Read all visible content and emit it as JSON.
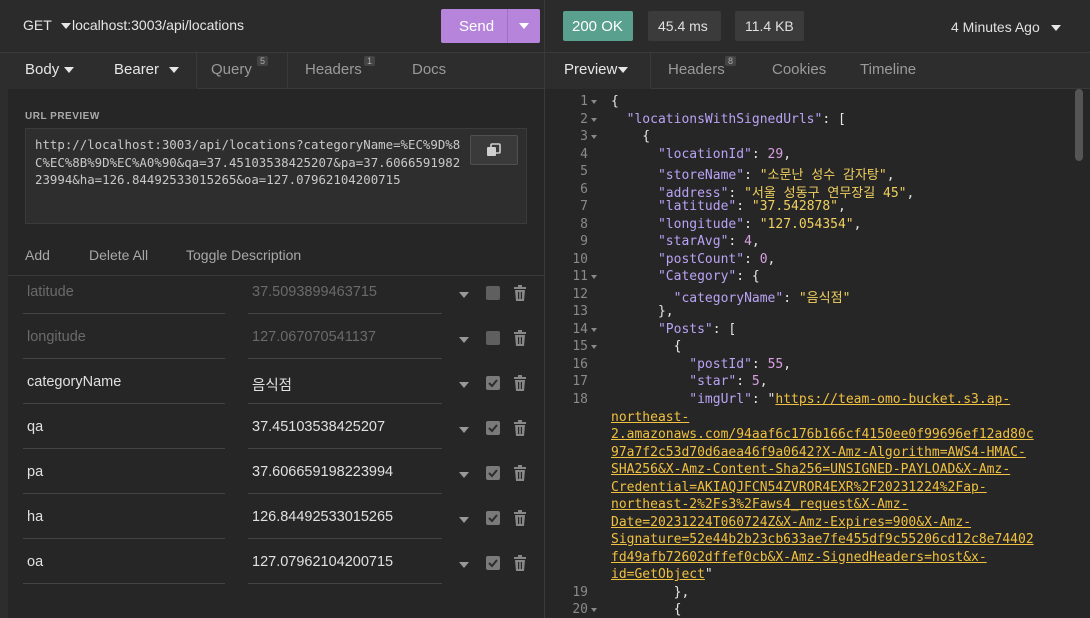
{
  "request": {
    "method": "GET",
    "url": "localhost:3003/api/locations",
    "send_label": "Send"
  },
  "response_meta": {
    "status": "200 OK",
    "time": "45.4 ms",
    "size": "11.4 KB",
    "ago": "4 Minutes Ago"
  },
  "left_tabs": [
    {
      "label": "Body",
      "badge": ""
    },
    {
      "label": "Bearer",
      "badge": ""
    },
    {
      "label": "Query",
      "badge": "5"
    },
    {
      "label": "Headers",
      "badge": "1"
    },
    {
      "label": "Docs",
      "badge": ""
    }
  ],
  "right_tabs": [
    {
      "label": "Preview",
      "badge": ""
    },
    {
      "label": "Headers",
      "badge": "8"
    },
    {
      "label": "Cookies",
      "badge": ""
    },
    {
      "label": "Timeline",
      "badge": ""
    }
  ],
  "url_preview": {
    "label": "URL PREVIEW",
    "text": "http://localhost:3003/api/locations?categoryName=%EC%9D%8C%EC%8B%9D%EC%A0%90&qa=37.45103538425207&pa=37.606659198223994&ha=126.84492533015265&oa=127.07962104200715"
  },
  "query_actions": {
    "add": "Add",
    "delete_all": "Delete All",
    "toggle_description": "Toggle Description"
  },
  "params": [
    {
      "name": "latitude",
      "value": "37.5093899463715",
      "enabled": false
    },
    {
      "name": "longitude",
      "value": "127.067070541137",
      "enabled": false
    },
    {
      "name": "categoryName",
      "value": "음식점",
      "enabled": true
    },
    {
      "name": "qa",
      "value": "37.45103538425207",
      "enabled": true
    },
    {
      "name": "pa",
      "value": "37.606659198223994",
      "enabled": true
    },
    {
      "name": "ha",
      "value": "126.84492533015265",
      "enabled": true
    },
    {
      "name": "oa",
      "value": "127.07962104200715",
      "enabled": true
    }
  ],
  "code": {
    "line_numbers": [
      "1",
      "2",
      "3",
      "4",
      "5",
      "6",
      "7",
      "8",
      "9",
      "10",
      "11",
      "12",
      "13",
      "14",
      "15",
      "16",
      "17",
      "18",
      "19",
      "20"
    ],
    "folds": [
      "1",
      "2",
      "3",
      "11",
      "14",
      "15",
      "20"
    ],
    "keys": {
      "root": "\"locationsWithSignedUrls\"",
      "locationId": "\"locationId\"",
      "storeName": "\"storeName\"",
      "address": "\"address\"",
      "latitude": "\"latitude\"",
      "longitude": "\"longitude\"",
      "starAvg": "\"starAvg\"",
      "postCount": "\"postCount\"",
      "Category": "\"Category\"",
      "categoryName": "\"categoryName\"",
      "Posts": "\"Posts\"",
      "postId": "\"postId\"",
      "star": "\"star\"",
      "imgUrl": "\"imgUrl\""
    },
    "values": {
      "locationId": "29",
      "storeName": "\"소문난 성수 감자탕\"",
      "address": "\"서울 성동구 연무장길 45\"",
      "latitude": "\"37.542878\"",
      "longitude": "\"127.054354\"",
      "starAvg": "4",
      "postCount": "0",
      "categoryName": "\"음식점\"",
      "postId": "55",
      "star": "5"
    },
    "img_url_lines": [
      "https://team-omo-bucket.s3.ap-",
      "northeast-",
      "2.amazonaws.com/94aaf6c176b166cf4150ee0f99696ef12ad80c",
      "97a7f2c53d70d6aea46f9a0642?X-Amz-Algorithm=AWS4-HMAC-",
      "SHA256&X-Amz-Content-Sha256=UNSIGNED-PAYLOAD&X-Amz-",
      "Credential=AKIAQJFCN54ZVROR4EXR%2F20231224%2Fap-",
      "northeast-2%2Fs3%2Faws4_request&X-Amz-",
      "Date=20231224T060724Z&X-Amz-Expires=900&X-Amz-",
      "Signature=52e44b2b23cb633ae7fe455df9c55206cd12c8e74402",
      "fd49afb72602dffef0cb&X-Amz-SignedHeaders=host&x-",
      "id=GetObject"
    ]
  }
}
